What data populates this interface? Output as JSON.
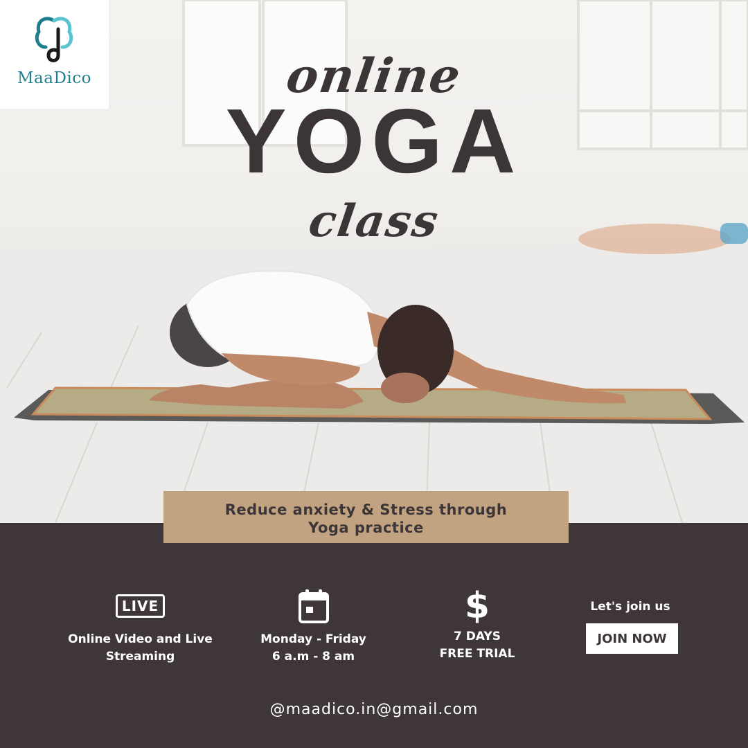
{
  "brand": {
    "name": "MaaDico",
    "logo_icon": "maadico-logo-icon",
    "color": "#1f7f8e"
  },
  "title": {
    "line1": "online",
    "line2": "YOGA",
    "line3": "class"
  },
  "tagline": "Reduce anxiety & Stress through Yoga practice",
  "features": [
    {
      "icon": "live-icon",
      "icon_text": "LIVE",
      "label": "Online Video and Live Streaming"
    },
    {
      "icon": "calendar-icon",
      "label": "Monday - Friday\n6 a.m - 8 am"
    },
    {
      "icon": "dollar-icon",
      "icon_text": "$",
      "label": "7 DAYS\nFREE TRIAL"
    }
  ],
  "cta": {
    "prompt": "Let's join us",
    "button_label": "JOIN NOW"
  },
  "contact": {
    "email": "@maadico.in@gmail.com"
  },
  "colors": {
    "dark": "#3e3639",
    "text_dark": "#3c3538",
    "tan": "#c1a382",
    "white": "#ffffff"
  }
}
